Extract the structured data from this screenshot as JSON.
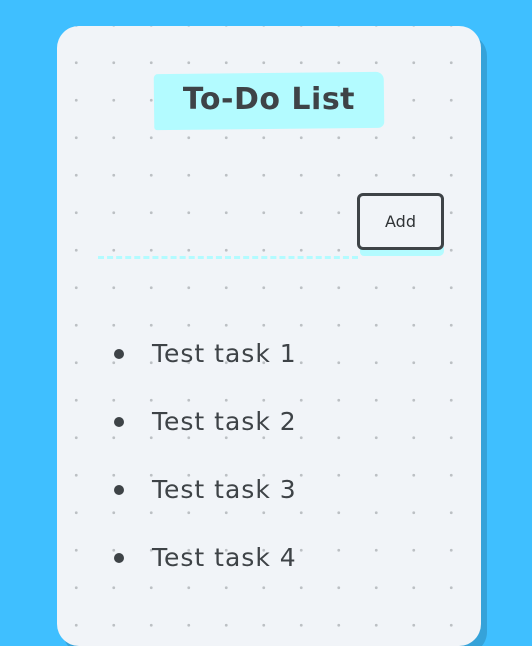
{
  "app": {
    "title": "To-Do List"
  },
  "form": {
    "input_value": "",
    "input_placeholder": "",
    "add_label": "Add"
  },
  "tasks": [
    {
      "label": "Test task 1"
    },
    {
      "label": "Test task 2"
    },
    {
      "label": "Test task 3"
    },
    {
      "label": "Test task 4"
    }
  ],
  "colors": {
    "background": "#3fbfff",
    "card": "#f1f4f8",
    "highlight": "#b3fbff",
    "text": "#3e4347",
    "dot_grid": "#bcc0c4"
  }
}
